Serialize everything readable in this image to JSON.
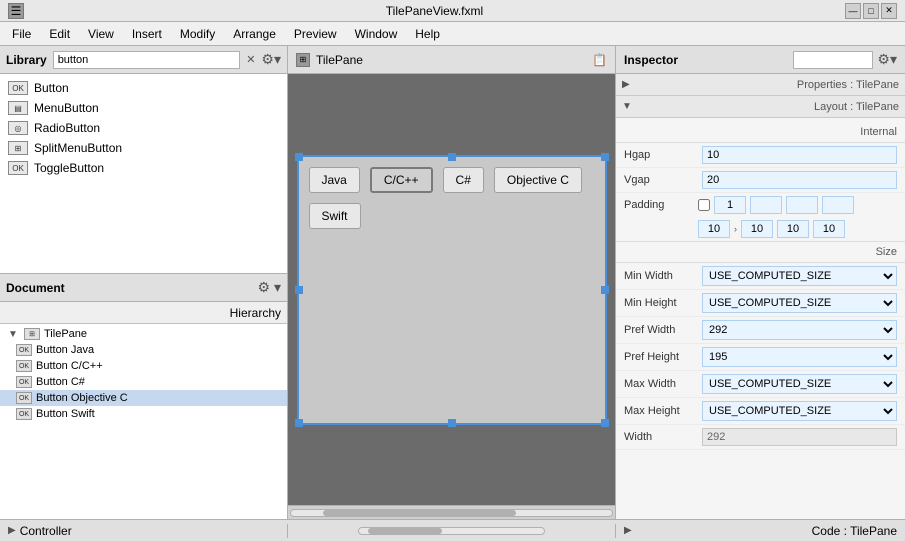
{
  "titlebar": {
    "title": "TilePaneView.fxml",
    "icon": "☰",
    "minimize": "—",
    "maximize": "□",
    "close": "✕"
  },
  "menubar": {
    "items": [
      "File",
      "Edit",
      "View",
      "Insert",
      "Modify",
      "Arrange",
      "Preview",
      "Window",
      "Help"
    ]
  },
  "library": {
    "title": "Library",
    "search_placeholder": "button",
    "items": [
      {
        "label": "Button"
      },
      {
        "label": "MenuButton"
      },
      {
        "label": "RadioButton"
      },
      {
        "label": "SplitMenuButton"
      },
      {
        "label": "ToggleButton"
      }
    ],
    "settings_icon": "⚙",
    "clear_icon": "✕"
  },
  "document": {
    "title": "Document",
    "settings_icon": "⚙",
    "hierarchy_label": "Hierarchy",
    "tree": {
      "root": "TilePane",
      "children": [
        {
          "label": "Button",
          "value": "Java"
        },
        {
          "label": "Button",
          "value": "C/C++"
        },
        {
          "label": "Button",
          "value": "C#"
        },
        {
          "label": "Button",
          "value": "Objective C",
          "selected": true
        },
        {
          "label": "Button",
          "value": "Swift"
        }
      ]
    }
  },
  "canvas": {
    "title": "TilePane",
    "buttons": [
      {
        "label": "Java",
        "selected": false
      },
      {
        "label": "C/C++",
        "selected": true
      },
      {
        "label": "C#",
        "selected": false
      },
      {
        "label": "Objective C",
        "selected": false
      },
      {
        "label": "Swift",
        "selected": false
      }
    ]
  },
  "inspector": {
    "title": "Inspector",
    "search_placeholder": "",
    "properties_label": "Properties : TilePane",
    "layout_label": "Layout : TilePane",
    "internal_label": "Internal",
    "size_label": "Size",
    "fields": {
      "hgap_label": "Hgap",
      "hgap_value": "10",
      "vgap_label": "Vgap",
      "vgap_value": "20",
      "padding_label": "Padding",
      "padding_values": [
        "10",
        "10",
        "10",
        "10"
      ],
      "min_width_label": "Min Width",
      "min_width_value": "USE_COMPUTED_SIZE",
      "min_height_label": "Min Height",
      "min_height_value": "USE_COMPUTED_SIZE",
      "pref_width_label": "Pref Width",
      "pref_width_value": "292",
      "pref_height_label": "Pref Height",
      "pref_height_value": "195",
      "max_width_label": "Max Width",
      "max_width_value": "USE_COMPUTED_SIZE",
      "max_height_label": "Max Height",
      "max_height_value": "USE_COMPUTED_SIZE",
      "width_label": "Width",
      "width_value": "292"
    }
  },
  "statusbar": {
    "left_arrow": "▶",
    "controller_label": "Controller",
    "code_label": "Code : TilePane",
    "right_arrow": "▶"
  }
}
